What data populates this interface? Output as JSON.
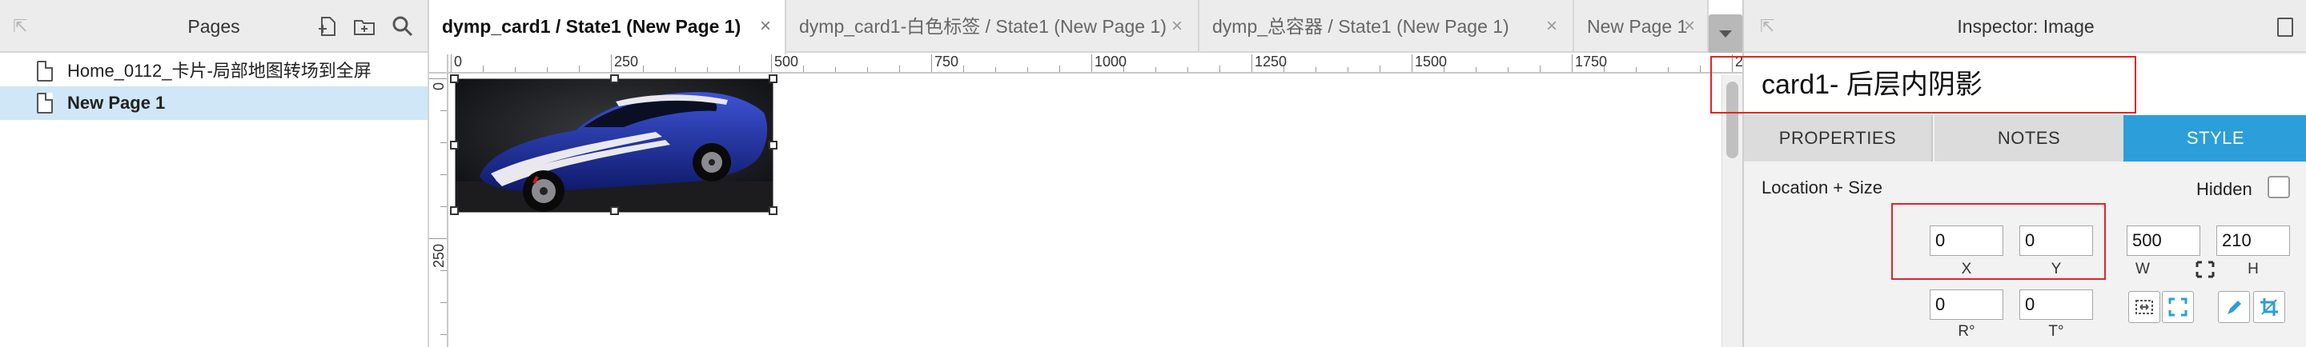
{
  "pages_panel": {
    "title": "Pages",
    "items": [
      {
        "label": "Home_0112_卡片-局部地图转场到全屏"
      },
      {
        "label": "New Page 1"
      }
    ]
  },
  "tabs": [
    {
      "label": "dymp_card1 / State1 (New Page 1)"
    },
    {
      "label": "dymp_card1-白色标签 / State1 (New Page 1)"
    },
    {
      "label": "dymp_总容器 / State1 (New Page 1)"
    },
    {
      "label": "New Page 1"
    }
  ],
  "tab_close_glyph": "×",
  "ruler": {
    "top_labels": [
      "0",
      "250",
      "500",
      "750",
      "1000",
      "1250",
      "1500",
      "1750",
      "2"
    ],
    "left_labels": [
      "0",
      "250"
    ]
  },
  "inspector": {
    "title": "Inspector: Image",
    "widget_name": "card1- 后层内阴影",
    "tabs": {
      "properties": "PROPERTIES",
      "notes": "NOTES",
      "style": "STYLE"
    },
    "location_size_label": "Location + Size",
    "hidden_label": "Hidden",
    "fields": {
      "x": {
        "value": "0",
        "caption": "X"
      },
      "y": {
        "value": "0",
        "caption": "Y"
      },
      "w": {
        "value": "500",
        "caption": "W"
      },
      "h": {
        "value": "210",
        "caption": "H"
      },
      "r": {
        "value": "0",
        "caption": "R°"
      },
      "t": {
        "value": "0",
        "caption": "T°"
      }
    }
  },
  "colors": {
    "accent": "#2c9ed9",
    "selection": "#cfe7f6",
    "highlight_box": "#e0242b",
    "car_body": "#1d2f9e"
  },
  "icons": [
    "collapse-arrow-icon",
    "add-page-icon",
    "add-folder-icon",
    "search-icon",
    "page-doc-icon",
    "lock-aspect-icon",
    "fit-image-icon",
    "fill-image-icon",
    "pen-icon",
    "crop-icon"
  ]
}
